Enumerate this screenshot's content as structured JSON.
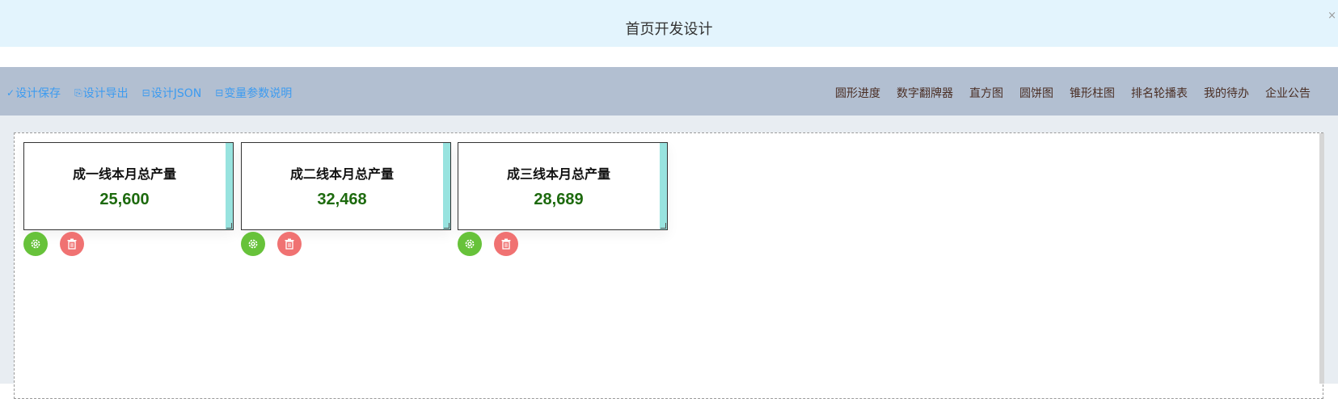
{
  "window": {
    "title": "首页开发设计",
    "close_label": "×"
  },
  "toolbar": {
    "left_actions": [
      {
        "icon": "check-icon",
        "glyph": "✓",
        "label": "设计保存"
      },
      {
        "icon": "copy-icon",
        "glyph": "⎘",
        "label": "设计导出"
      },
      {
        "icon": "document-icon",
        "glyph": "⊟",
        "label": "设计JSON"
      },
      {
        "icon": "document-icon",
        "glyph": "⊟",
        "label": "变量参数说明"
      }
    ],
    "components": [
      "圆形进度",
      "数字翻牌器",
      "直方图",
      "圆饼图",
      "锥形柱图",
      "排名轮播表",
      "我的待办",
      "企业公告"
    ]
  },
  "cards": [
    {
      "label": "成一线本月总产量",
      "value": "25,600"
    },
    {
      "label": "成二线本月总产量",
      "value": "32,468"
    },
    {
      "label": "成三线本月总产量",
      "value": "28,689"
    }
  ],
  "colors": {
    "titlebar_bg": "#e3f4fd",
    "toolbar_bg": "#b2bfd1",
    "action_link": "#3c9bf0",
    "value_green": "#1d6a0e",
    "card_stripe": "#98e3df",
    "settings_button": "#67c23a",
    "delete_button": "#f07272"
  }
}
